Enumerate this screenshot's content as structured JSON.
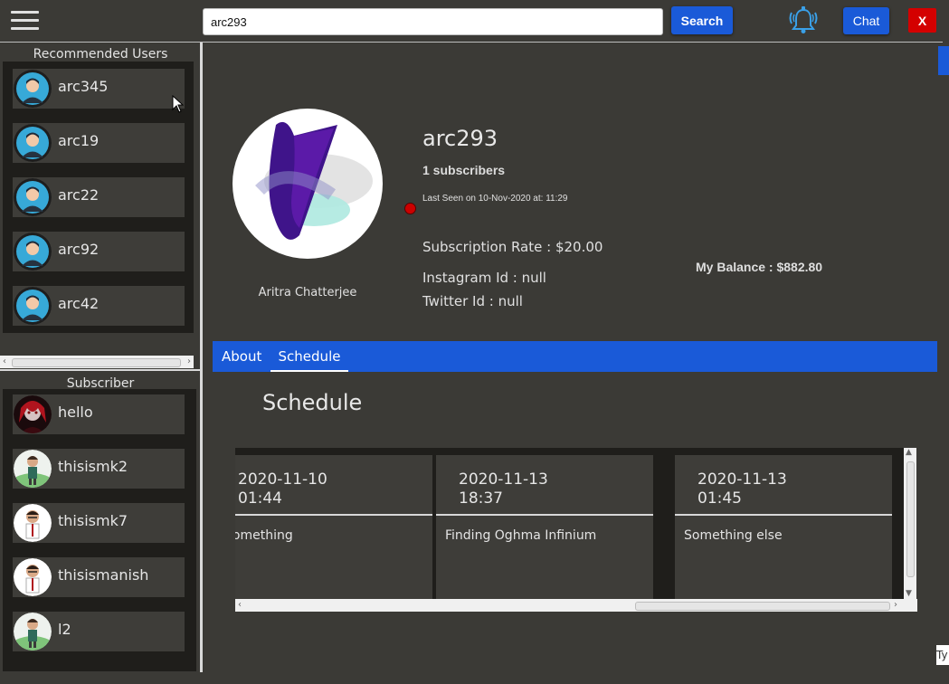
{
  "header": {
    "search_value": "arc293",
    "search_button": "Search",
    "chat_button": "Chat",
    "close_button": "X"
  },
  "sidebar": {
    "recommended_title": "Recommended Users",
    "recommended": [
      {
        "name": "arc345"
      },
      {
        "name": "arc19"
      },
      {
        "name": "arc22"
      },
      {
        "name": "arc92"
      },
      {
        "name": "arc42"
      }
    ],
    "subscriber_title": "Subscriber",
    "subscribers": [
      {
        "name": "hello"
      },
      {
        "name": "thisismk2"
      },
      {
        "name": "thisismk7"
      },
      {
        "name": "thisismanish"
      },
      {
        "name": "l2"
      }
    ]
  },
  "profile": {
    "username": "arc293",
    "full_name": "Aritra Chatterjee",
    "subscribers": "1 subscribers",
    "last_seen": "Last Seen on 10-Nov-2020 at: 11:29",
    "subscription_rate": "Subscription Rate : $20.00",
    "instagram": "Instagram Id : null",
    "twitter": "Twitter Id : null",
    "balance": "My Balance : $882.80",
    "status_color": "#cc0000"
  },
  "tabs": [
    {
      "label": "About",
      "active": false
    },
    {
      "label": "Schedule",
      "active": true
    }
  ],
  "schedule": {
    "heading": "Schedule",
    "cards": [
      {
        "date": "2020-11-10\n01:44",
        "desc": "Something"
      },
      {
        "date": "2020-11-13\n18:37",
        "desc": "Finding Oghma Infinium"
      },
      {
        "date": "2020-11-13\n01:45",
        "desc": "Something else"
      }
    ]
  },
  "corner_text": "Ty",
  "colors": {
    "accent": "#1a5ad8",
    "close": "#d40000",
    "background": "#3b3a36"
  }
}
